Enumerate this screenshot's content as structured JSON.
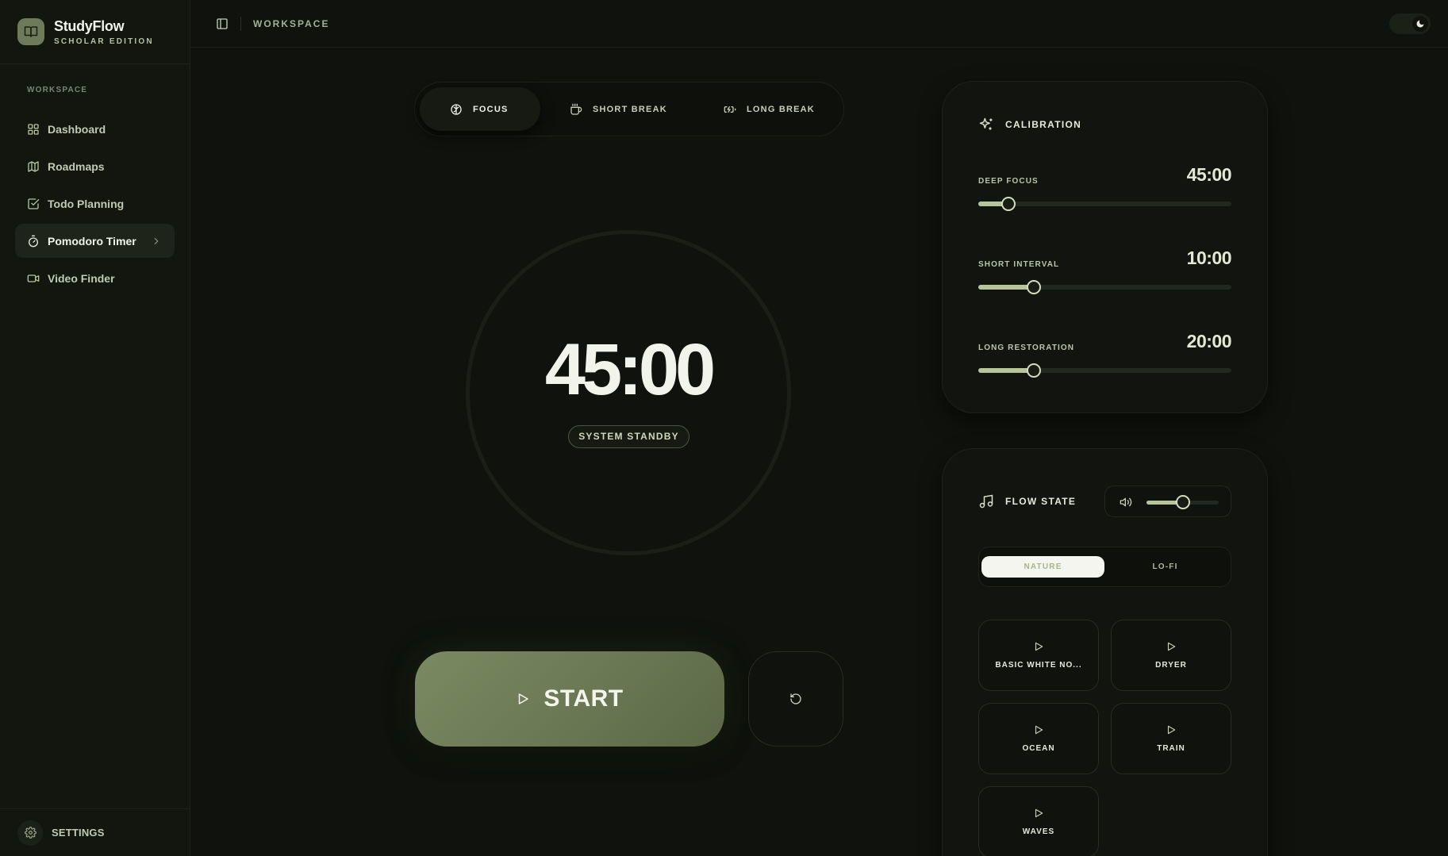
{
  "brand": {
    "name": "StudyFlow",
    "subtitle": "SCHOLAR EDITION"
  },
  "sidebar": {
    "section_label": "WORKSPACE",
    "items": [
      {
        "label": "Dashboard",
        "icon": "grid-icon",
        "active": false
      },
      {
        "label": "Roadmaps",
        "icon": "map-icon",
        "active": false
      },
      {
        "label": "Todo Planning",
        "icon": "checkbox-icon",
        "active": false
      },
      {
        "label": "Pomodoro Timer",
        "icon": "stopwatch-icon",
        "active": true
      },
      {
        "label": "Video Finder",
        "icon": "video-icon",
        "active": false
      }
    ],
    "settings_label": "SETTINGS"
  },
  "topbar": {
    "title": "WORKSPACE"
  },
  "modes": [
    {
      "label": "FOCUS",
      "icon": "brain-icon",
      "active": true
    },
    {
      "label": "SHORT BREAK",
      "icon": "coffee-icon",
      "active": false
    },
    {
      "label": "LONG BREAK",
      "icon": "battery-icon",
      "active": false
    }
  ],
  "timer": {
    "display": "45:00",
    "status": "SYSTEM STANDBY"
  },
  "controls": {
    "start_label": "START"
  },
  "calibration": {
    "title": "CALIBRATION",
    "rows": [
      {
        "label": "DEEP FOCUS",
        "value": "45:00",
        "level": 0.12
      },
      {
        "label": "SHORT INTERVAL",
        "value": "10:00",
        "level": 0.22
      },
      {
        "label": "LONG RESTORATION",
        "value": "20:00",
        "level": 0.22
      }
    ]
  },
  "flow_state": {
    "title": "FLOW STATE",
    "volume_level": 0.5,
    "tabs": [
      {
        "label": "NATURE",
        "active": true
      },
      {
        "label": "LO-FI",
        "active": false
      }
    ],
    "sounds": [
      "BASIC WHITE NO...",
      "DRYER",
      "OCEAN",
      "TRAIN",
      "WAVES"
    ]
  },
  "colors": {
    "background": "#0f120d",
    "accent": "#7b8a63",
    "slider_fill": "#b7c59b",
    "text": "#f2f3ea"
  }
}
